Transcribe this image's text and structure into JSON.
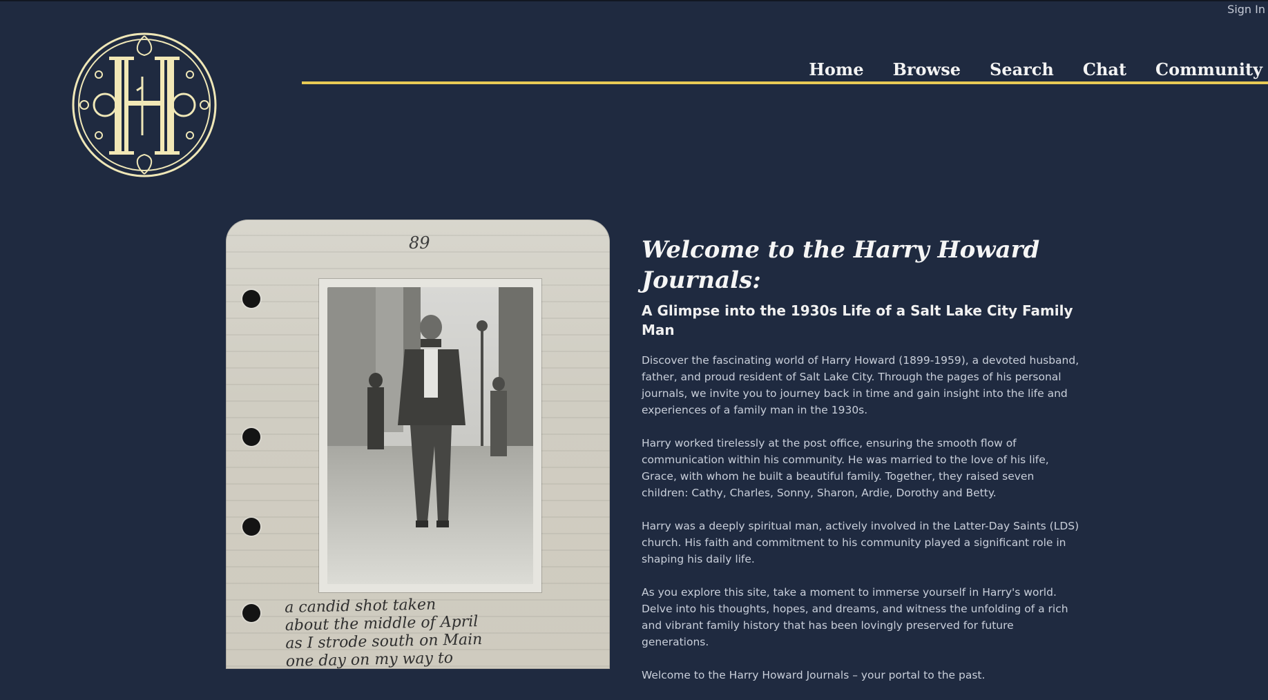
{
  "header": {
    "signin_label": "Sign In",
    "nav": [
      {
        "label": "Home"
      },
      {
        "label": "Browse"
      },
      {
        "label": "Search"
      },
      {
        "label": "Chat"
      },
      {
        "label": "Community"
      }
    ],
    "colors": {
      "background": "#1f2a40",
      "accent": "#e8ca55",
      "nav_text": "#f3f3f3"
    }
  },
  "journal": {
    "page_number": "89",
    "caption": "a candid shot taken\nabout the middle of April\nas I strode south on Main\none day on my way to"
  },
  "main": {
    "title": "Welcome to the Harry Howard Journals:",
    "subtitle": "A Glimpse into the 1930s Life of a Salt Lake City Family Man",
    "paragraphs": [
      "Discover the fascinating world of Harry Howard (1899-1959), a devoted husband, father, and proud resident of Salt Lake City. Through the pages of his personal journals, we invite you to journey back in time and gain insight into the life and experiences of a family man in the 1930s.",
      "Harry worked tirelessly at the post office, ensuring the smooth flow of communication within his community. He was married to the love of his life, Grace, with whom he built a beautiful family. Together, they raised seven children: Cathy, Charles, Sonny, Sharon, Ardie, Dorothy and Betty.",
      "Harry was a deeply spiritual man, actively involved in the Latter-Day Saints (LDS) church. His faith and commitment to his community played a significant role in shaping his daily life.",
      "As you explore this site, take a moment to immerse yourself in Harry's world. Delve into his thoughts, hopes, and dreams, and witness the unfolding of a rich and vibrant family history that has been lovingly preserved for future generations.",
      "Welcome to the Harry Howard Journals – your portal to the past."
    ]
  }
}
